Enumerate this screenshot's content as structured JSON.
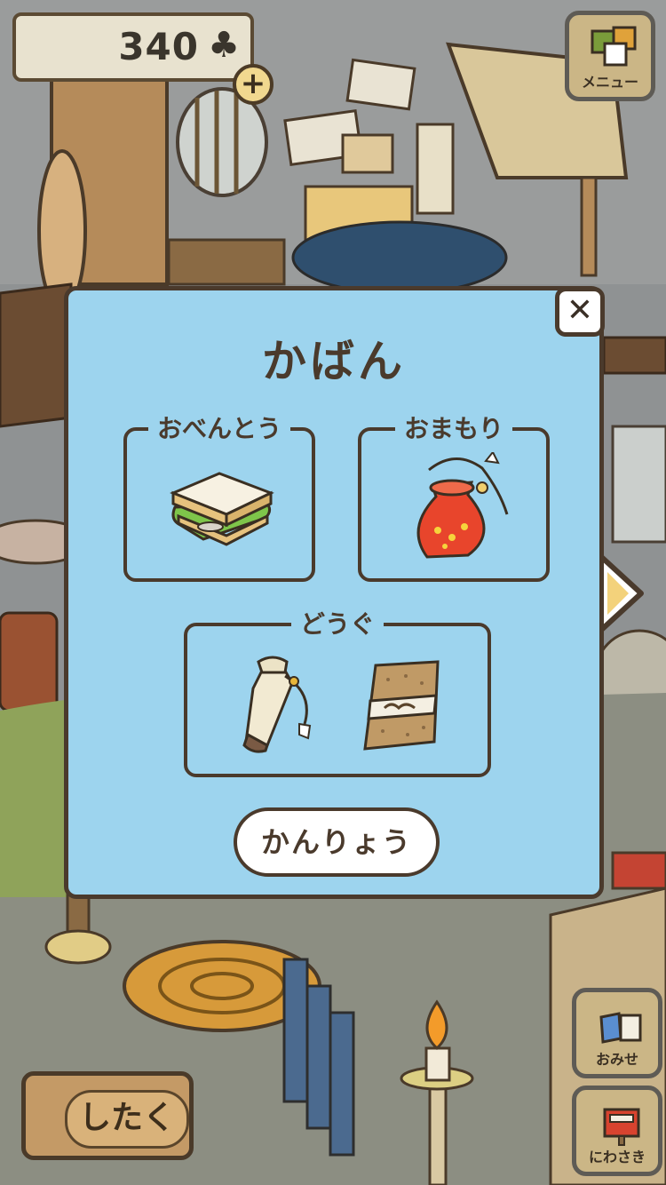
{
  "hud": {
    "clover_count": "340",
    "clover_symbol": "♣",
    "add_symbol": "+"
  },
  "menu": {
    "label": "メニュー"
  },
  "bag_modal": {
    "title": "かばん",
    "close_symbol": "✕",
    "slots": {
      "bento": {
        "label": "おべんとう",
        "item": "sandwich"
      },
      "omamori": {
        "label": "おまもり",
        "item": "red-charm-pouch"
      },
      "dougu": {
        "label": "どうぐ",
        "items": [
          "bottle",
          "tenugui-towel"
        ]
      }
    },
    "confirm_label": "かんりょう"
  },
  "bottom_bar": {
    "shitaku_label": "したく",
    "shop_label": "おみせ",
    "garden_label": "にわさき"
  },
  "colors": {
    "modal_bg": "#9dd4ee",
    "outline": "#4a3a2c",
    "charm": "#e8452c"
  }
}
